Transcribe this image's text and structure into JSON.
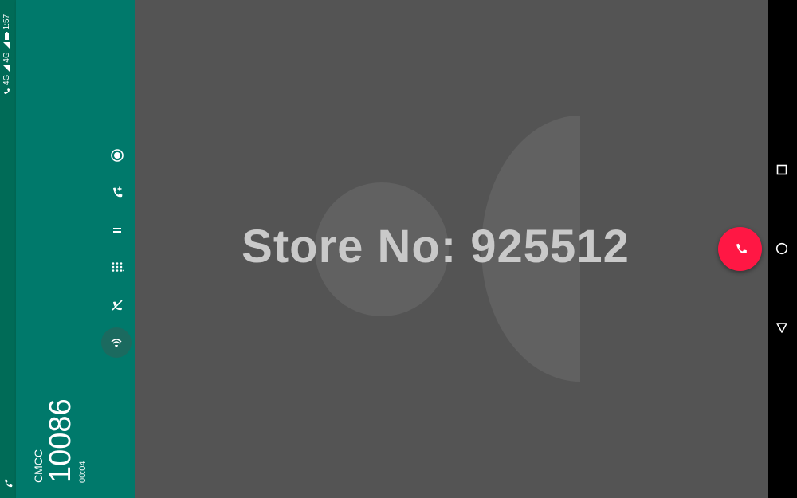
{
  "status_bar": {
    "time": "1:57",
    "network_1": "4G",
    "network_2": "4G",
    "icons": [
      "battery-icon",
      "signal-icon",
      "signal-icon",
      "hd-call-icon",
      "phone-icon"
    ]
  },
  "call": {
    "carrier": "CMCC",
    "number": "10086",
    "duration": "00:04"
  },
  "controls": [
    {
      "name": "record-icon"
    },
    {
      "name": "add-call-icon"
    },
    {
      "name": "hold-icon"
    },
    {
      "name": "dialpad-icon"
    },
    {
      "name": "mute-icon"
    },
    {
      "name": "speaker-icon"
    }
  ],
  "watermark": "Store No: 925512",
  "colors": {
    "panel": "#00796b",
    "status_strip": "#006b57",
    "end_call": "#ff1744",
    "background": "#545454"
  },
  "nav": [
    "recents-icon",
    "home-icon",
    "back-icon"
  ]
}
